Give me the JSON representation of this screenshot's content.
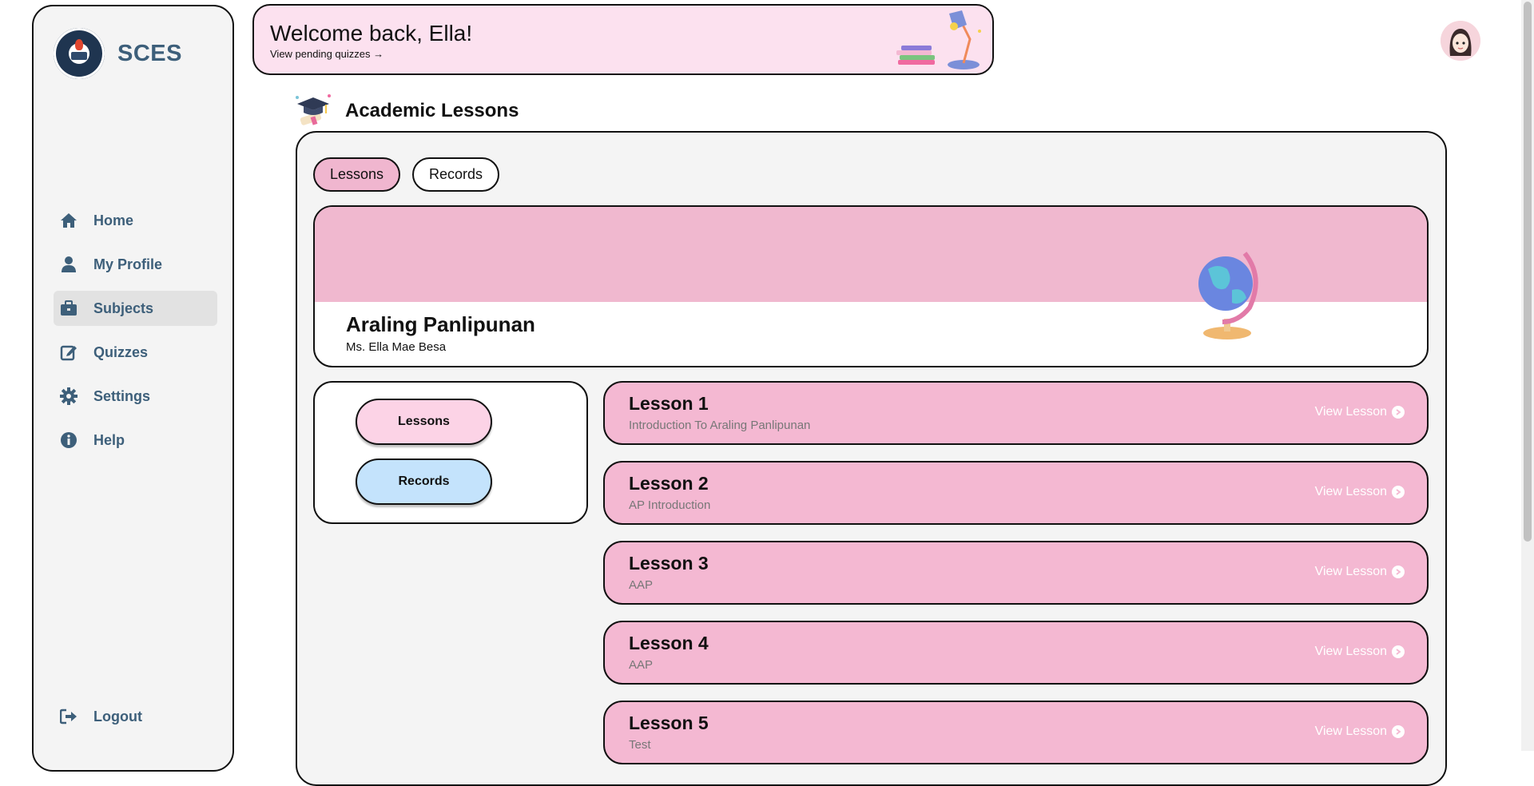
{
  "sidebar": {
    "brand": "SCES",
    "items": [
      {
        "label": "Home",
        "icon": "home-icon"
      },
      {
        "label": "My Profile",
        "icon": "user-icon"
      },
      {
        "label": "Subjects",
        "icon": "briefcase-icon"
      },
      {
        "label": "Quizzes",
        "icon": "edit-icon"
      },
      {
        "label": "Settings",
        "icon": "gear-icon"
      },
      {
        "label": "Help",
        "icon": "info-icon"
      }
    ],
    "logout": "Logout"
  },
  "banner": {
    "greeting": "Welcome back, Ella!",
    "pending": "View pending quizzes →"
  },
  "section": {
    "title": "Academic Lessons"
  },
  "tabs": [
    "Lessons",
    "Records"
  ],
  "subject": {
    "name": "Araling Panlipunan",
    "teacher": "Ms. Ella Mae Besa"
  },
  "side_buttons": [
    "Lessons",
    "Records"
  ],
  "lessons": [
    {
      "title": "Lesson 1",
      "subtitle": "Introduction To Araling Panlipunan",
      "link": "View Lesson"
    },
    {
      "title": "Lesson 2",
      "subtitle": "AP Introduction",
      "link": "View Lesson"
    },
    {
      "title": "Lesson 3",
      "subtitle": "AAP",
      "link": "View Lesson"
    },
    {
      "title": "Lesson 4",
      "subtitle": "AAP",
      "link": "View Lesson"
    },
    {
      "title": "Lesson 5",
      "subtitle": "Test",
      "link": "View Lesson"
    }
  ],
  "colors": {
    "nav_text": "#3d5f7a",
    "banner_bg": "#fce1ef",
    "lesson_bg": "#f4b8d2",
    "tab_active": "#f0b6cf",
    "records_pill": "#c4e3fc"
  }
}
